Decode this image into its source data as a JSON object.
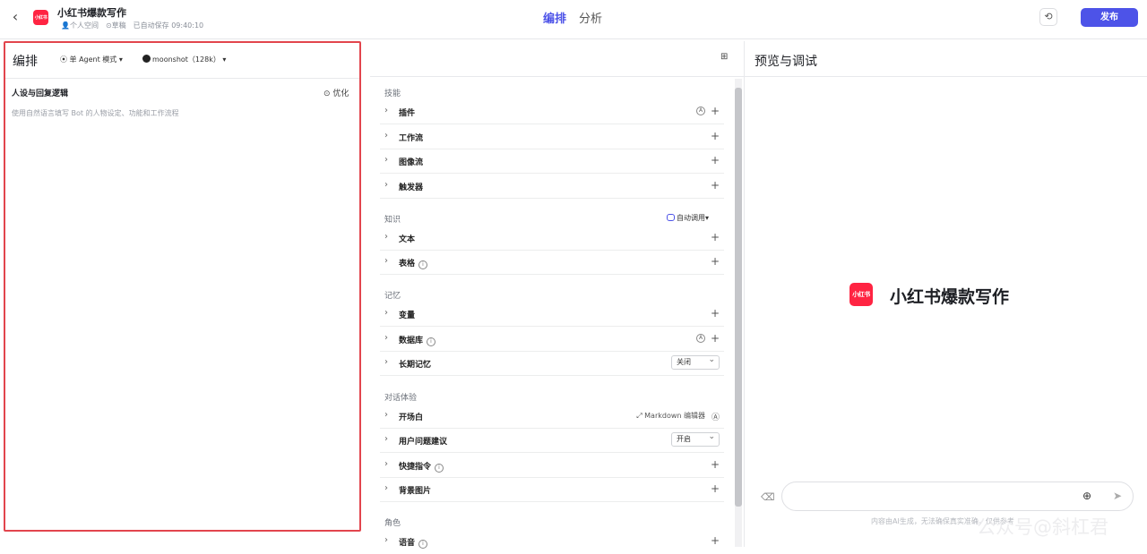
{
  "header": {
    "back_icon": "chevron-left-icon",
    "logo_text": "小红书",
    "app_title": "小红书爆款写作",
    "meta_space": "个人空间",
    "meta_status": "草稿",
    "meta_saved": "已自动保存 09:40:10",
    "tabs": [
      {
        "label": "编排",
        "active": true
      },
      {
        "label": "分析",
        "active": false
      }
    ],
    "publish_label": "发布",
    "accent": "#4d53e8"
  },
  "left": {
    "title": "编排",
    "mode_label": "单 Agent 模式",
    "model_label": "moonshot（128k）",
    "persona_title": "人设与回复逻辑",
    "optimize_label": "优化",
    "persona_placeholder": "使用自然语言填写 Bot 的人物设定、功能和工作流程"
  },
  "mid": {
    "sections": {
      "skills": "技能",
      "knowledge": "知识",
      "memory": "记忆",
      "experience": "对话体验",
      "role": "角色"
    },
    "auto_call": "自动调用",
    "rows": {
      "plugin": "插件",
      "workflow": "工作流",
      "imageflow": "图像流",
      "trigger": "触发器",
      "text": "文本",
      "table": "表格",
      "variable": "变量",
      "database": "数据库",
      "longterm": "长期记忆",
      "opening": "开场白",
      "suggest": "用户问题建议",
      "shortcut": "快捷指令",
      "background": "背景图片",
      "voice": "语音"
    },
    "longterm_value": "关闭",
    "suggest_value": "开启",
    "markdown_label": "Markdown 编辑器"
  },
  "right": {
    "title": "预览与调试",
    "bot_logo_text": "小红书",
    "bot_name": "小红书爆款写作",
    "disclaimer": "内容由AI生成，无法确保真实准确，仅供参考",
    "watermark": "公众号@斜杠君"
  }
}
